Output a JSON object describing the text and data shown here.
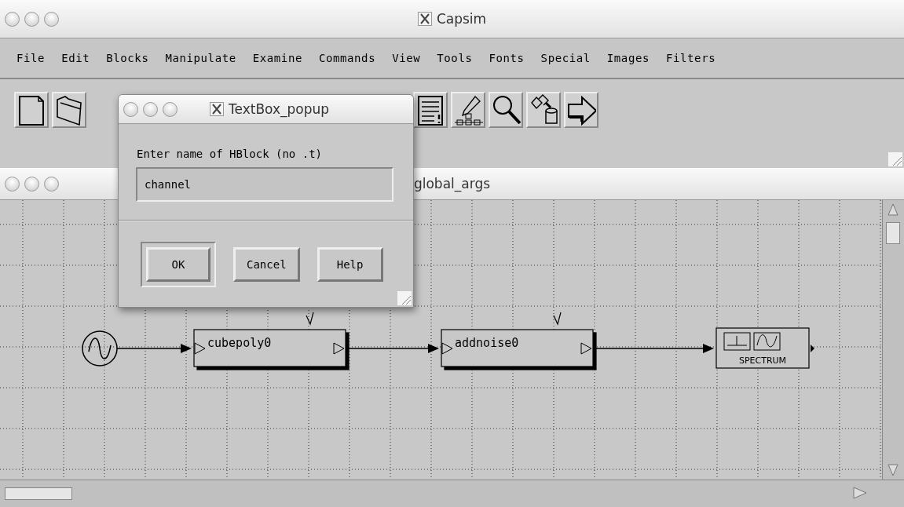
{
  "main_window": {
    "title": "Capsim"
  },
  "menu": [
    "File",
    "Edit",
    "Blocks",
    "Manipulate",
    "Examine",
    "Commands",
    "View",
    "Tools",
    "Fonts",
    "Special",
    "Images",
    "Filters"
  ],
  "diagram_window": {
    "title": "global_args"
  },
  "diagram": {
    "blocks": [
      {
        "kind": "source"
      },
      {
        "kind": "block",
        "label": "cubepoly0"
      },
      {
        "kind": "block",
        "label": "addnoise0"
      },
      {
        "kind": "sink",
        "label": "SPECTRUM"
      }
    ]
  },
  "dialog": {
    "title": "TextBox_popup",
    "prompt": "Enter name of HBlock (no .t)",
    "field": {
      "value": "channel"
    },
    "buttons": [
      {
        "label": "OK",
        "default": true
      },
      {
        "label": "Cancel",
        "default": false
      },
      {
        "label": "Help",
        "default": false
      }
    ]
  }
}
